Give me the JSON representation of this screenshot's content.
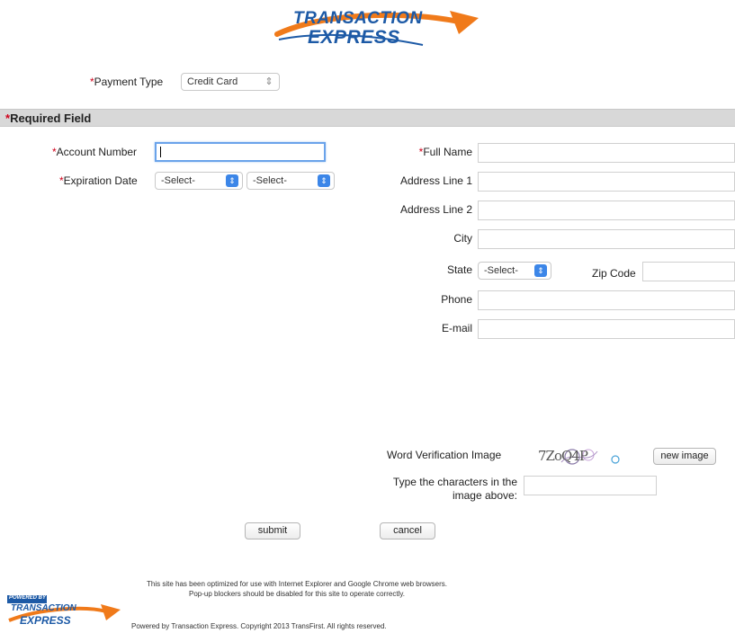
{
  "header": {
    "logo_line1": "TRANSACTION",
    "logo_line2": "EXPRESS"
  },
  "payment": {
    "label": "Payment Type",
    "value": "Credit Card"
  },
  "required_bar": {
    "label": "Required Field"
  },
  "left_form": {
    "account_number_label": "Account Number",
    "account_number_value": "",
    "expiration_label": "Expiration Date",
    "exp_month_value": "-Select-",
    "exp_year_value": "-Select-"
  },
  "right_form": {
    "full_name_label": "Full Name",
    "address1_label": "Address Line 1",
    "address2_label": "Address Line 2",
    "city_label": "City",
    "state_label": "State",
    "state_value": "-Select-",
    "zip_label": "Zip Code",
    "phone_label": "Phone",
    "email_label": "E-mail"
  },
  "verification": {
    "label": "Word Verification Image",
    "captcha_text": "7ZoQ4P",
    "new_image_label": "new image",
    "type_chars_label_line1": "Type the characters in the",
    "type_chars_label_line2": "image above:"
  },
  "actions": {
    "submit_label": "submit",
    "cancel_label": "cancel"
  },
  "footer": {
    "note_line1": "This site has been optimized for use with Internet Explorer and Google Chrome web browsers.",
    "note_line2": "Pop-up blockers should be disabled for this site to operate correctly.",
    "powered_by": "POWERED BY",
    "powered_logo_line1": "TRANSACTION",
    "powered_logo_line2": "EXPRESS",
    "copyright": "Powered by Transaction Express. Copyright 2013 TransFirst. All rights reserved."
  },
  "colors": {
    "required": "#d0021b",
    "logo_blue": "#1d5aa6",
    "logo_orange": "#f07a1a",
    "select_accent": "#3c86e8",
    "section_bar": "#d8d8d8"
  }
}
